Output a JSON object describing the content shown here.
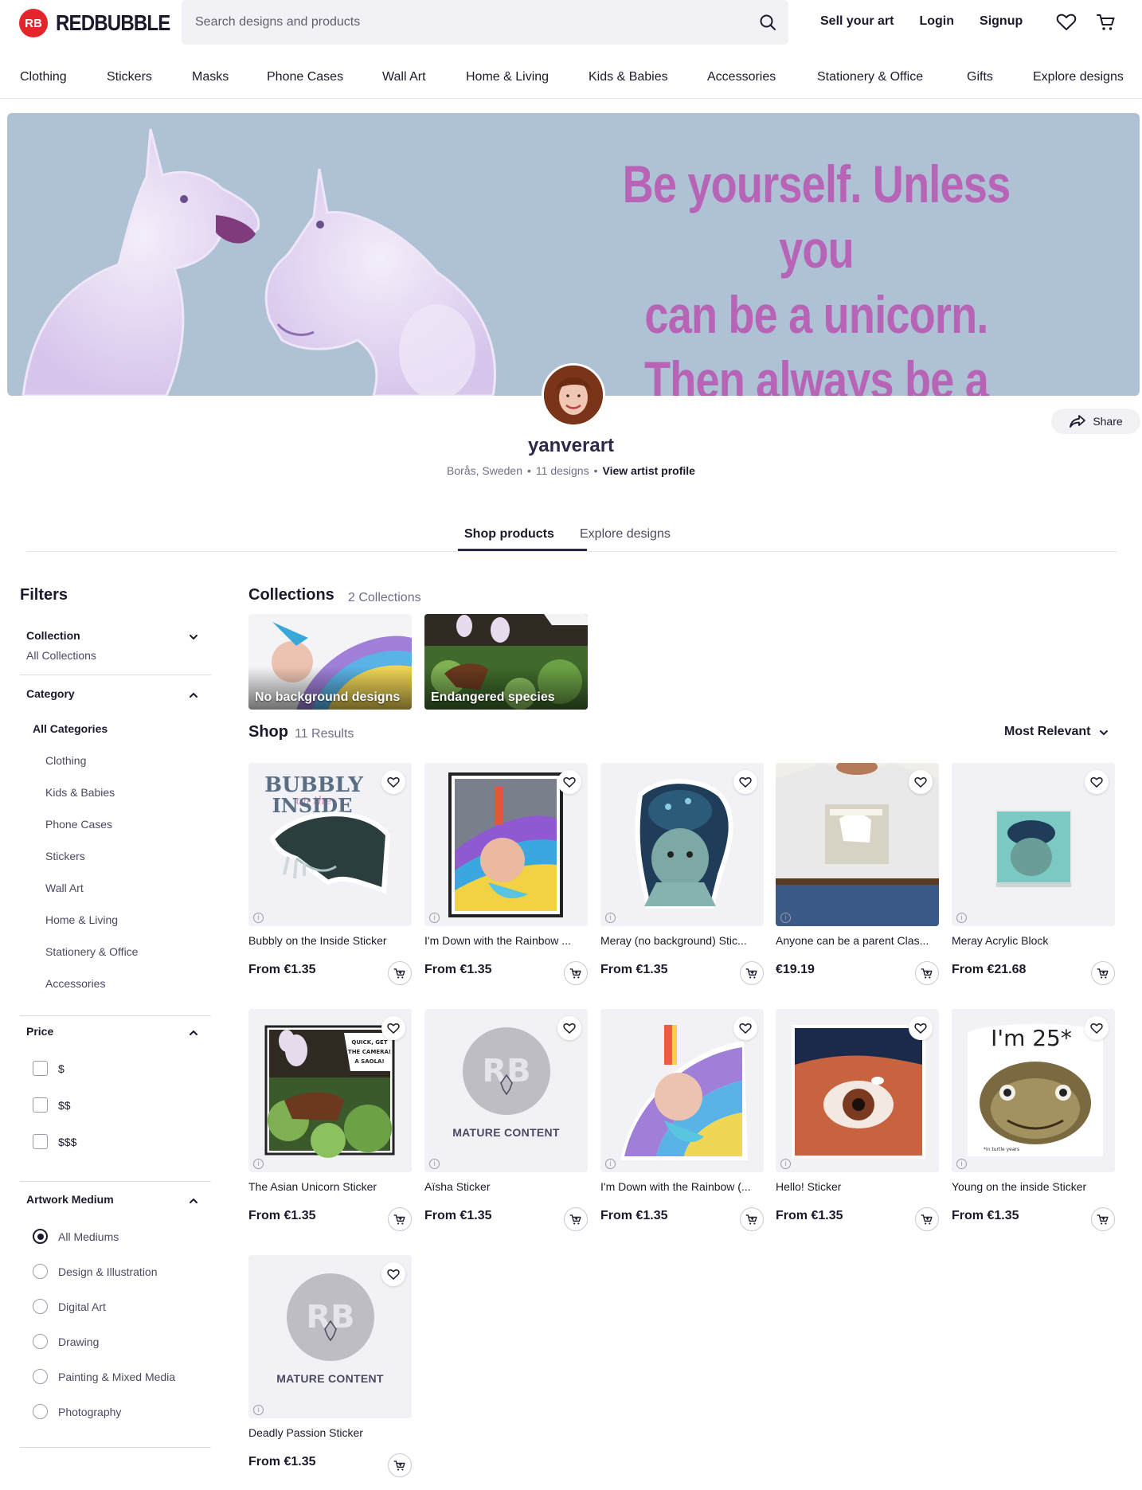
{
  "brand": {
    "logo_mark": "RB",
    "name": "REDBUBBLE"
  },
  "search": {
    "placeholder": "Search designs and products"
  },
  "header_links": {
    "sell": "Sell your art",
    "login": "Login",
    "signup": "Signup"
  },
  "nav": [
    "Clothing",
    "Stickers",
    "Masks",
    "Phone Cases",
    "Wall Art",
    "Home & Living",
    "Kids & Babies",
    "Accessories",
    "Stationery & Office",
    "Gifts",
    "Explore designs"
  ],
  "banner": {
    "line1": "Be yourself. Unless you",
    "line2": "can be a unicorn.",
    "line3": "Then always be a unicorn."
  },
  "profile": {
    "name": "yanverart",
    "location": "Borås, Sweden",
    "designs": "11 designs",
    "view_profile": "View artist profile",
    "share": "Share"
  },
  "tabs": {
    "shop_products": "Shop products",
    "explore_designs": "Explore designs"
  },
  "filters": {
    "title": "Filters",
    "collection": {
      "title": "Collection",
      "value": "All Collections"
    },
    "category": {
      "title": "Category",
      "all": "All Categories",
      "items": [
        "Clothing",
        "Kids & Babies",
        "Phone Cases",
        "Stickers",
        "Wall Art",
        "Home & Living",
        "Stationery & Office",
        "Accessories"
      ]
    },
    "price": {
      "title": "Price",
      "options": [
        "$",
        "$$",
        "$$$"
      ]
    },
    "medium": {
      "title": "Artwork Medium",
      "options": [
        "All Mediums",
        "Design & Illustration",
        "Digital Art",
        "Drawing",
        "Painting & Mixed Media",
        "Photography"
      ],
      "selected": "All Mediums"
    }
  },
  "collections": {
    "title": "Collections",
    "count": "2 Collections",
    "items": [
      "No background designs",
      "Endangered species"
    ]
  },
  "shop": {
    "title": "Shop",
    "count": "11 Results",
    "sort": "Most Relevant",
    "products": [
      {
        "title": "Bubbly on the Inside Sticker",
        "price": "From €1.35",
        "art": "bubbly",
        "art_text_1": "BUBBLY",
        "art_text_2": "on the",
        "art_text_3": "INSIDE"
      },
      {
        "title": "I'm Down with the Rainbow ...",
        "price": "From €1.35",
        "art": "rainbow-print"
      },
      {
        "title": "Meray (no background) Stic...",
        "price": "From €1.35",
        "art": "meray"
      },
      {
        "title": "Anyone can be a parent Clas...",
        "price": "€19.19",
        "art": "tshirt"
      },
      {
        "title": "Meray Acrylic Block",
        "price": "From €21.68",
        "art": "acrylic"
      },
      {
        "title": "The Asian Unicorn Sticker",
        "price": "From €1.35",
        "art": "saola",
        "art_text_1": "QUICK, GET",
        "art_text_2": "THE CAMERA!",
        "art_text_3": "A SAOLA!"
      },
      {
        "title": "Aïsha Sticker",
        "price": "From €1.35",
        "art": "mature",
        "mature_label": "MATURE CONTENT"
      },
      {
        "title": "I'm Down with the Rainbow (...",
        "price": "From €1.35",
        "art": "rainbow-sticker"
      },
      {
        "title": "Hello! Sticker",
        "price": "From €1.35",
        "art": "eye"
      },
      {
        "title": "Young on the inside Sticker",
        "price": "From €1.35",
        "art": "turtle",
        "art_text_1": "I'm 25*",
        "art_text_2": "*in turtle years"
      },
      {
        "title": "Deadly Passion Sticker",
        "price": "From €1.35",
        "art": "mature",
        "mature_label": "MATURE CONTENT"
      }
    ]
  },
  "colors": {
    "brand_red": "#e4252c",
    "banner_bg": "#aec1d5",
    "banner_text": "#b763b6",
    "ink": "#1b1a2c"
  },
  "icons": [
    "search-icon",
    "heart-icon",
    "cart-icon",
    "share-icon",
    "chevron-down-icon",
    "chevron-up-icon",
    "info-icon",
    "add-to-cart-icon"
  ]
}
